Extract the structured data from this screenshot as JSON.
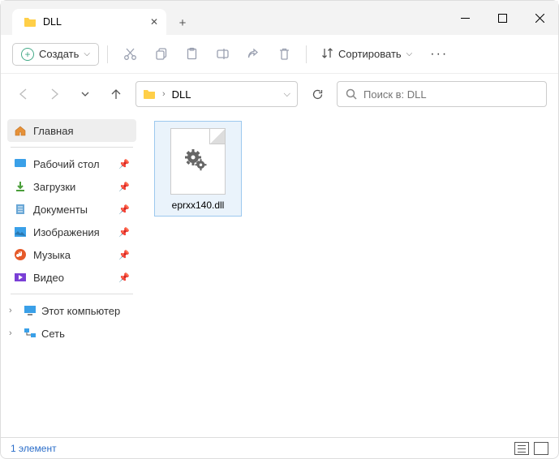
{
  "tab": {
    "title": "DLL"
  },
  "toolbar": {
    "create": "Создать",
    "sort": "Сортировать"
  },
  "breadcrumb": {
    "current": "DLL"
  },
  "search": {
    "placeholder": "Поиск в: DLL"
  },
  "sidebar": {
    "home": "Главная",
    "quick": [
      {
        "label": "Рабочий стол"
      },
      {
        "label": "Загрузки"
      },
      {
        "label": "Документы"
      },
      {
        "label": "Изображения"
      },
      {
        "label": "Музыка"
      },
      {
        "label": "Видео"
      }
    ],
    "this_pc": "Этот компьютер",
    "network": "Сеть"
  },
  "files": [
    {
      "name": "eprxx140.dll"
    }
  ],
  "status": {
    "count": "1 элемент"
  }
}
